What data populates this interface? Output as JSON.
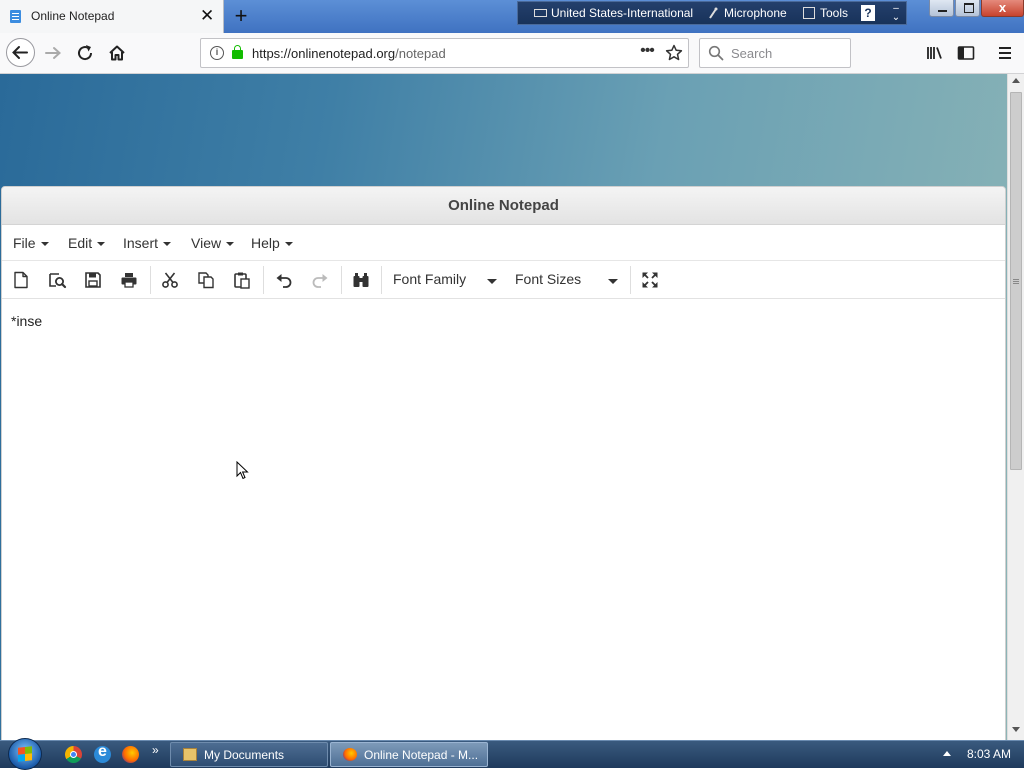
{
  "browser": {
    "tab": {
      "title": "Online Notepad",
      "close": "✕"
    },
    "new_tab": "+",
    "language_bar": {
      "language": "United States-International",
      "microphone": "Microphone",
      "tools": "Tools",
      "help": "?"
    },
    "window_controls": {
      "close": "x"
    },
    "url": {
      "host": "https://onlinenotepad.org",
      "path": "/notepad"
    },
    "url_more": "•••",
    "search": {
      "placeholder": "Search"
    }
  },
  "app": {
    "title": "Online Notepad",
    "menus": [
      "File",
      "Edit",
      "Insert",
      "View",
      "Help"
    ],
    "toolbar": {
      "font_family": "Font Family",
      "font_sizes": "Font Sizes"
    },
    "editor": {
      "content": "*inse"
    }
  },
  "taskbar": {
    "quick_launch_more": "»",
    "tasks": [
      "My Documents",
      "Online Notepad - M..."
    ],
    "clock": "8:03 AM"
  },
  "colors": {
    "page_gradient_start": "#2a6a99",
    "page_gradient_end": "#8cb5b6",
    "lock_green": "#12bc00",
    "taskbar": "#1f3a5c"
  },
  "icons": {
    "toolbar": [
      "new-document-icon",
      "open-preview-icon",
      "save-icon",
      "print-icon",
      "cut-icon",
      "copy-icon",
      "paste-icon",
      "undo-icon",
      "redo-icon",
      "find-binoculars-icon",
      "fullscreen-icon"
    ]
  }
}
